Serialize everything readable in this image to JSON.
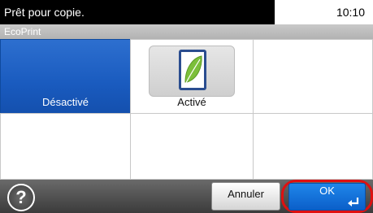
{
  "status": {
    "message": "Prêt pour copie.",
    "time": "10:10"
  },
  "title": "EcoPrint",
  "options": [
    {
      "label": "Désactivé",
      "selected": true
    },
    {
      "label": "Activé",
      "selected": false,
      "icon": "leaf-icon"
    }
  ],
  "footer": {
    "help_label": "?",
    "cancel_label": "Annuler",
    "ok_label": "OK"
  },
  "colors": {
    "selected": "#1a5bbf",
    "ok_button": "#1f86ea",
    "highlight_ring": "#e01010",
    "leaf": "#7cbf3a"
  }
}
